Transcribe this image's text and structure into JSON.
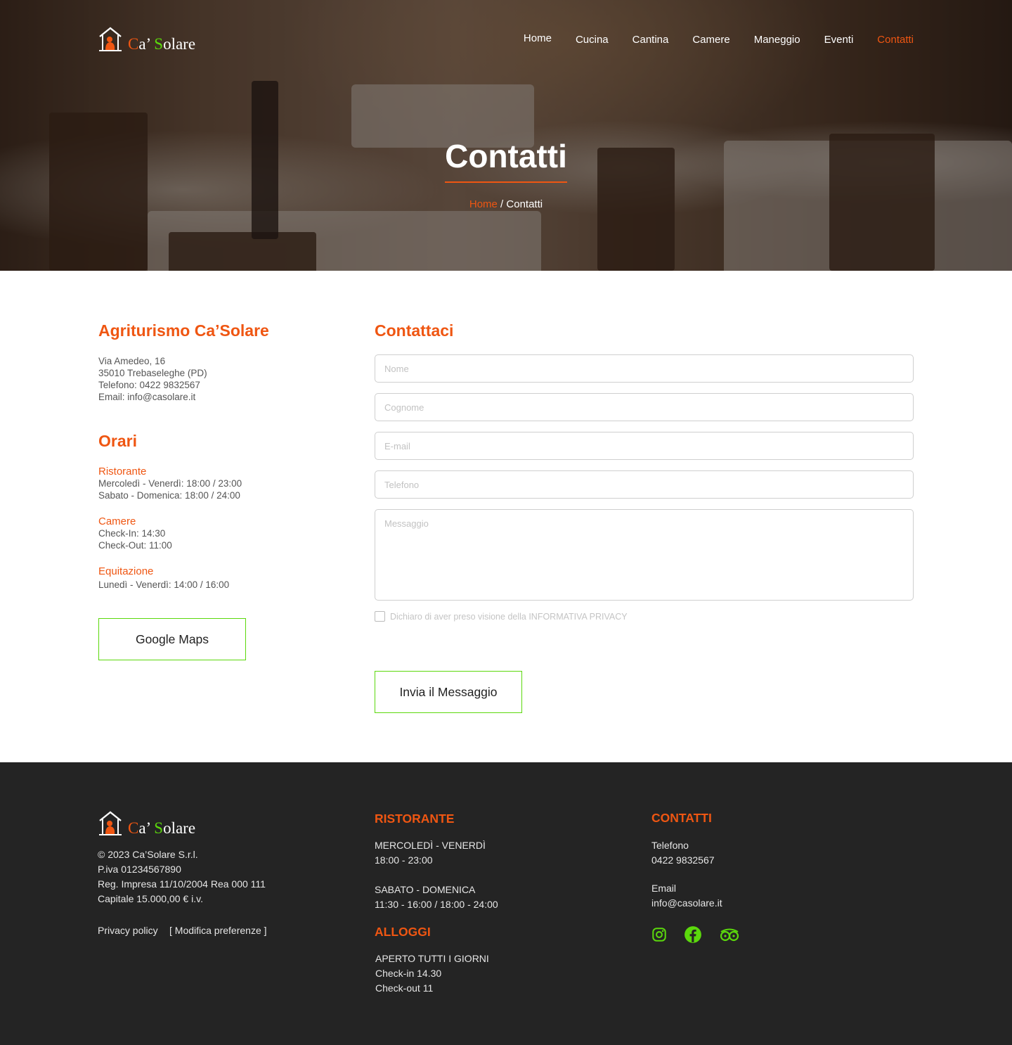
{
  "brand": {
    "name_part1": "C",
    "name_part2": "a’ ",
    "name_part3": "S",
    "name_part4": "olare"
  },
  "nav": {
    "items": [
      "Home",
      "Cucina",
      "Cantina",
      "Camere",
      "Maneggio",
      "Eventi",
      "Contatti"
    ],
    "active": "Contatti"
  },
  "hero": {
    "title": "Contatti",
    "breadcrumb_home": "Home",
    "breadcrumb_sep": " / ",
    "breadcrumb_current": "Contatti"
  },
  "info": {
    "title": "Agriturismo Ca’Solare",
    "address_line1": "Via Amedeo, 16",
    "address_line2": "35010 Trebaseleghe (PD)",
    "phone": "Telefono: 0422 9832567",
    "email": "Email: info@casolare.it"
  },
  "hours": {
    "title": "Orari",
    "ristorante_label": "Ristorante",
    "ristorante_line1": "Mercoledì - Venerdì: 18:00 / 23:00",
    "ristorante_line2": "Sabato - Domenica: 18:00 / 24:00",
    "camere_label": "Camere",
    "camere_line1": "Check-In: 14:30",
    "camere_line2": "Check-Out: 11:00",
    "equitazione_label": "Equitazione",
    "equitazione_line1": "Lunedì - Venerdì: 14:00 / 16:00"
  },
  "maps_button": "Google Maps",
  "form": {
    "title": "Contattaci",
    "nome_placeholder": "Nome",
    "cognome_placeholder": "Cognome",
    "email_placeholder": "E-mail",
    "telefono_placeholder": "Telefono",
    "messaggio_placeholder": "Messaggio",
    "privacy_label": "Dichiaro di aver preso visione della INFORMATIVA PRIVACY",
    "submit_label": "Invia il Messaggio"
  },
  "footer": {
    "copyright": "© 2023 Ca’Solare S.r.l.",
    "piva": "P.iva 01234567890",
    "reg": "Reg. Impresa 11/10/2004 Rea 000 111",
    "capitale": "Capitale 15.000,00 € i.v.",
    "privacy_link": "Privacy policy",
    "preferenze_link": "[ Modifica preferenze ]",
    "ristorante_title": "RISTORANTE",
    "rist_days1": "MERCOLEDÌ - VENERDÌ",
    "rist_hours1": "18:00 - 23:00",
    "rist_days2": "SABATO - DOMENICA",
    "rist_hours2": "11:30 - 16:00 / 18:00 - 24:00",
    "alloggi_title": "ALLOGGI",
    "alloggi_line1": "APERTO TUTTI I GIORNI",
    "alloggi_line2": "Check-in 14.30",
    "alloggi_line3": "Check-out 11",
    "contatti_title": "CONTATTI",
    "tel_label": "Telefono",
    "tel_value": "0422 9832567",
    "email_label": "Email",
    "email_value": "info@casolare.it",
    "social_icons": [
      "instagram-icon",
      "facebook-icon",
      "tripadvisor-icon"
    ]
  },
  "colors": {
    "accent": "#ef5612",
    "green": "#5bd80c",
    "footer_bg": "#242424"
  }
}
